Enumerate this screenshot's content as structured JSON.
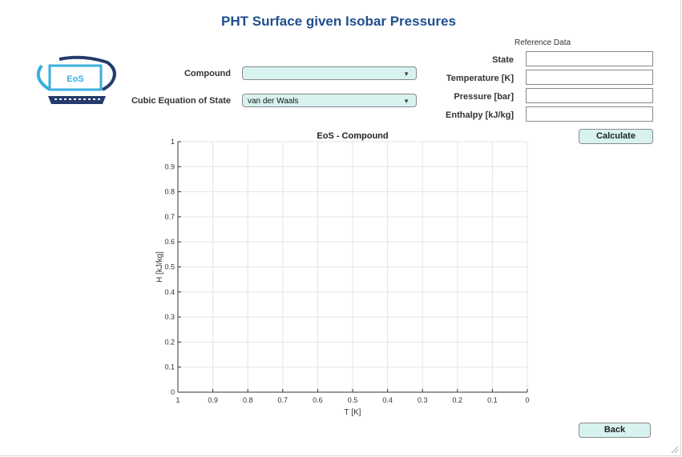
{
  "window": {
    "title": "PHT Surface given Isobar Pressures"
  },
  "logo": {
    "text": "EoS"
  },
  "form": {
    "compound_label": "Compound",
    "compound_value": "",
    "eos_label": "Cubic Equation of State",
    "eos_value": "van der Waals"
  },
  "reference": {
    "title": "Reference Data",
    "state_label": "State",
    "state_value": "",
    "temperature_label": "Temperature [K]",
    "temperature_value": "",
    "pressure_label": "Pressure [bar]",
    "pressure_value": "",
    "enthalpy_label": "Enthalpy [kJ/kg]",
    "enthalpy_value": ""
  },
  "buttons": {
    "calculate": "Calculate",
    "back": "Back"
  },
  "colors": {
    "accent": "#1f4e8c",
    "button_fill": "#d8f2f0",
    "logo_blue": "#3aaee0",
    "logo_dark": "#243b6b"
  },
  "chart_data": {
    "type": "line",
    "title": "EoS - Compound",
    "xlabel": "T [K]",
    "ylabel": "H [kJ/kg]",
    "xlim": [
      1,
      0
    ],
    "ylim": [
      0,
      1
    ],
    "xticks": [
      "1",
      "0.9",
      "0.8",
      "0.7",
      "0.6",
      "0.5",
      "0.4",
      "0.3",
      "0.2",
      "0.1",
      "0"
    ],
    "yticks": [
      "0",
      "0.1",
      "0.2",
      "0.3",
      "0.4",
      "0.5",
      "0.6",
      "0.7",
      "0.8",
      "0.9",
      "1"
    ],
    "grid": true,
    "series": []
  }
}
